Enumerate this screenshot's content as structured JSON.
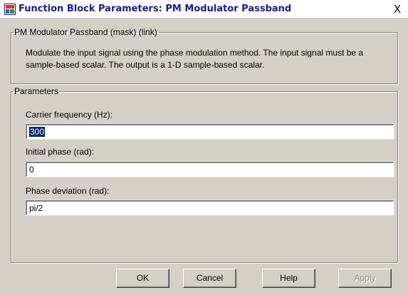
{
  "window": {
    "title": "Function Block Parameters: PM Modulator Passband",
    "close_glyph": "X"
  },
  "mask_group": {
    "legend": "PM Modulator Passband (mask) (link)",
    "description": "Modulate the input signal using the phase modulation method. The input signal must be a sample-based scalar. The output is a 1-D sample-based scalar."
  },
  "parameters_group": {
    "legend": "Parameters",
    "fields": [
      {
        "label": "Carrier frequency (Hz):",
        "value": "300"
      },
      {
        "label": "Initial phase (rad):",
        "value": "0"
      },
      {
        "label": "Phase deviation (rad):",
        "value": "pi/2"
      }
    ]
  },
  "buttons": {
    "ok": "OK",
    "cancel": "Cancel",
    "help": "Help",
    "apply": "Apply"
  },
  "colors": {
    "title_text": "#1b1b8a",
    "selection": "#0a246a",
    "dialog_bg": "#d4d0c8"
  }
}
